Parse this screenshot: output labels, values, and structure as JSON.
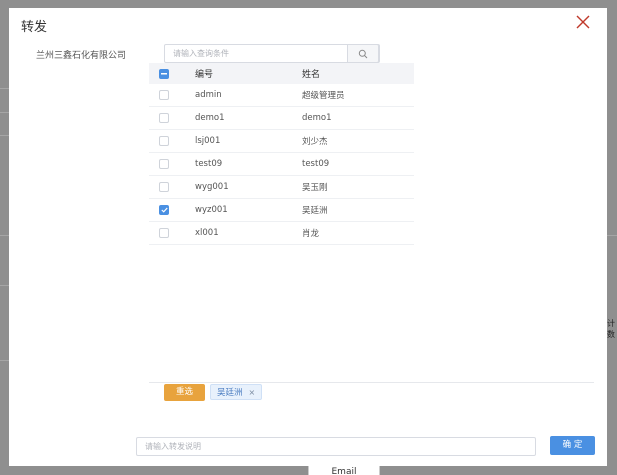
{
  "modal": {
    "title": "转发",
    "company": "兰州三鑫石化有限公司",
    "search_placeholder": "请输入查询条件"
  },
  "table": {
    "headers": {
      "id": "编号",
      "name": "姓名"
    },
    "rows": [
      {
        "id": "admin",
        "name": "超级管理员",
        "checked": false
      },
      {
        "id": "demo1",
        "name": "demo1",
        "checked": false
      },
      {
        "id": "lsj001",
        "name": "刘少杰",
        "checked": false
      },
      {
        "id": "test09",
        "name": "test09",
        "checked": false
      },
      {
        "id": "wyg001",
        "name": "吴玉刚",
        "checked": false
      },
      {
        "id": "wyz001",
        "name": "吴廷洲",
        "checked": true
      },
      {
        "id": "xl001",
        "name": "肖龙",
        "checked": false
      }
    ]
  },
  "selection": {
    "reset_label": "重选",
    "chip_label": "吴廷洲",
    "chip_close": "×"
  },
  "footer": {
    "remark_placeholder": "请输入转发说明",
    "confirm_label": "确 定"
  },
  "background": {
    "email_label": "Email",
    "side_text": "计 数"
  },
  "colors": {
    "primary": "#4a90e2",
    "warning": "#e8a33d",
    "close": "#c0392b"
  }
}
